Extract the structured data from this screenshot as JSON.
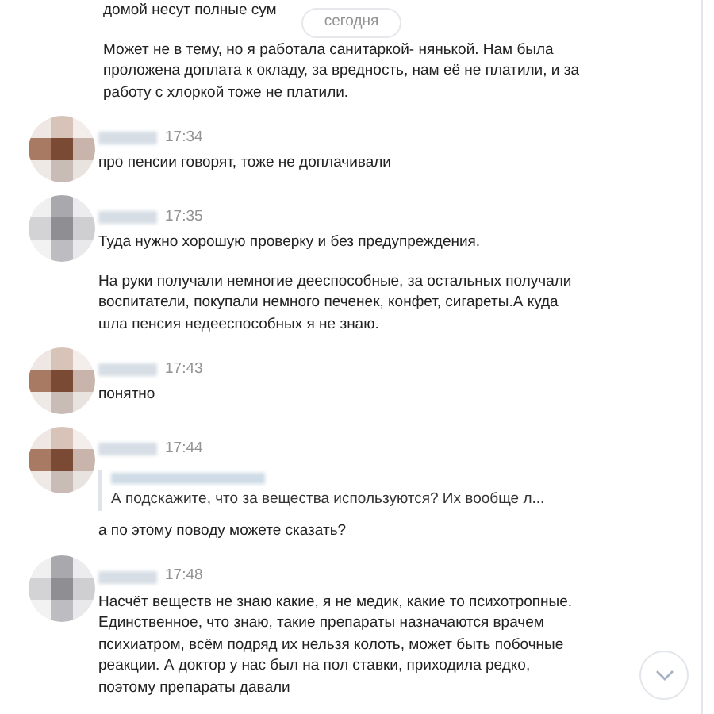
{
  "date_pill": "сегодня",
  "messages": [
    {
      "kind": "continuation",
      "paragraphs": [
        "домой несут полные сум",
        "Может не в тему, но я работала санитаркой- нянькой. Нам была проложена доплата к окладу, за вредность, нам её не платили, и за работу с хлоркой тоже не платили."
      ]
    },
    {
      "kind": "post",
      "time": "17:34",
      "paragraphs": [
        "про пенсии говорят, тоже не доплачивали"
      ]
    },
    {
      "kind": "post",
      "time": "17:35",
      "paragraphs": [
        "Туда нужно хорошую проверку и без предупреждения.",
        "На руки получали немногие дееспособные, за остальных получали воспитатели, покупали немного печенек, конфет, сигареты.А куда шла пенсия недееспособных я не знаю."
      ]
    },
    {
      "kind": "post",
      "time": "17:43",
      "paragraphs": [
        "понятно"
      ]
    },
    {
      "kind": "post",
      "time": "17:44",
      "quote": "А подскажите, что за вещества используются? Их вообще л...",
      "paragraphs": [
        "а по этому поводу можете сказать?"
      ]
    },
    {
      "kind": "post",
      "time": "17:48",
      "paragraphs": [
        "Насчёт веществ не знаю какие, я не медик, какие то психотропные. Единственное, что знаю, такие препараты назначаются врачем психиатром, всём подряд их нельзя колоть, может быть побочные реакции. А доктор у нас был на пол ставки, приходила редко, поэтому препараты давали"
      ]
    }
  ]
}
